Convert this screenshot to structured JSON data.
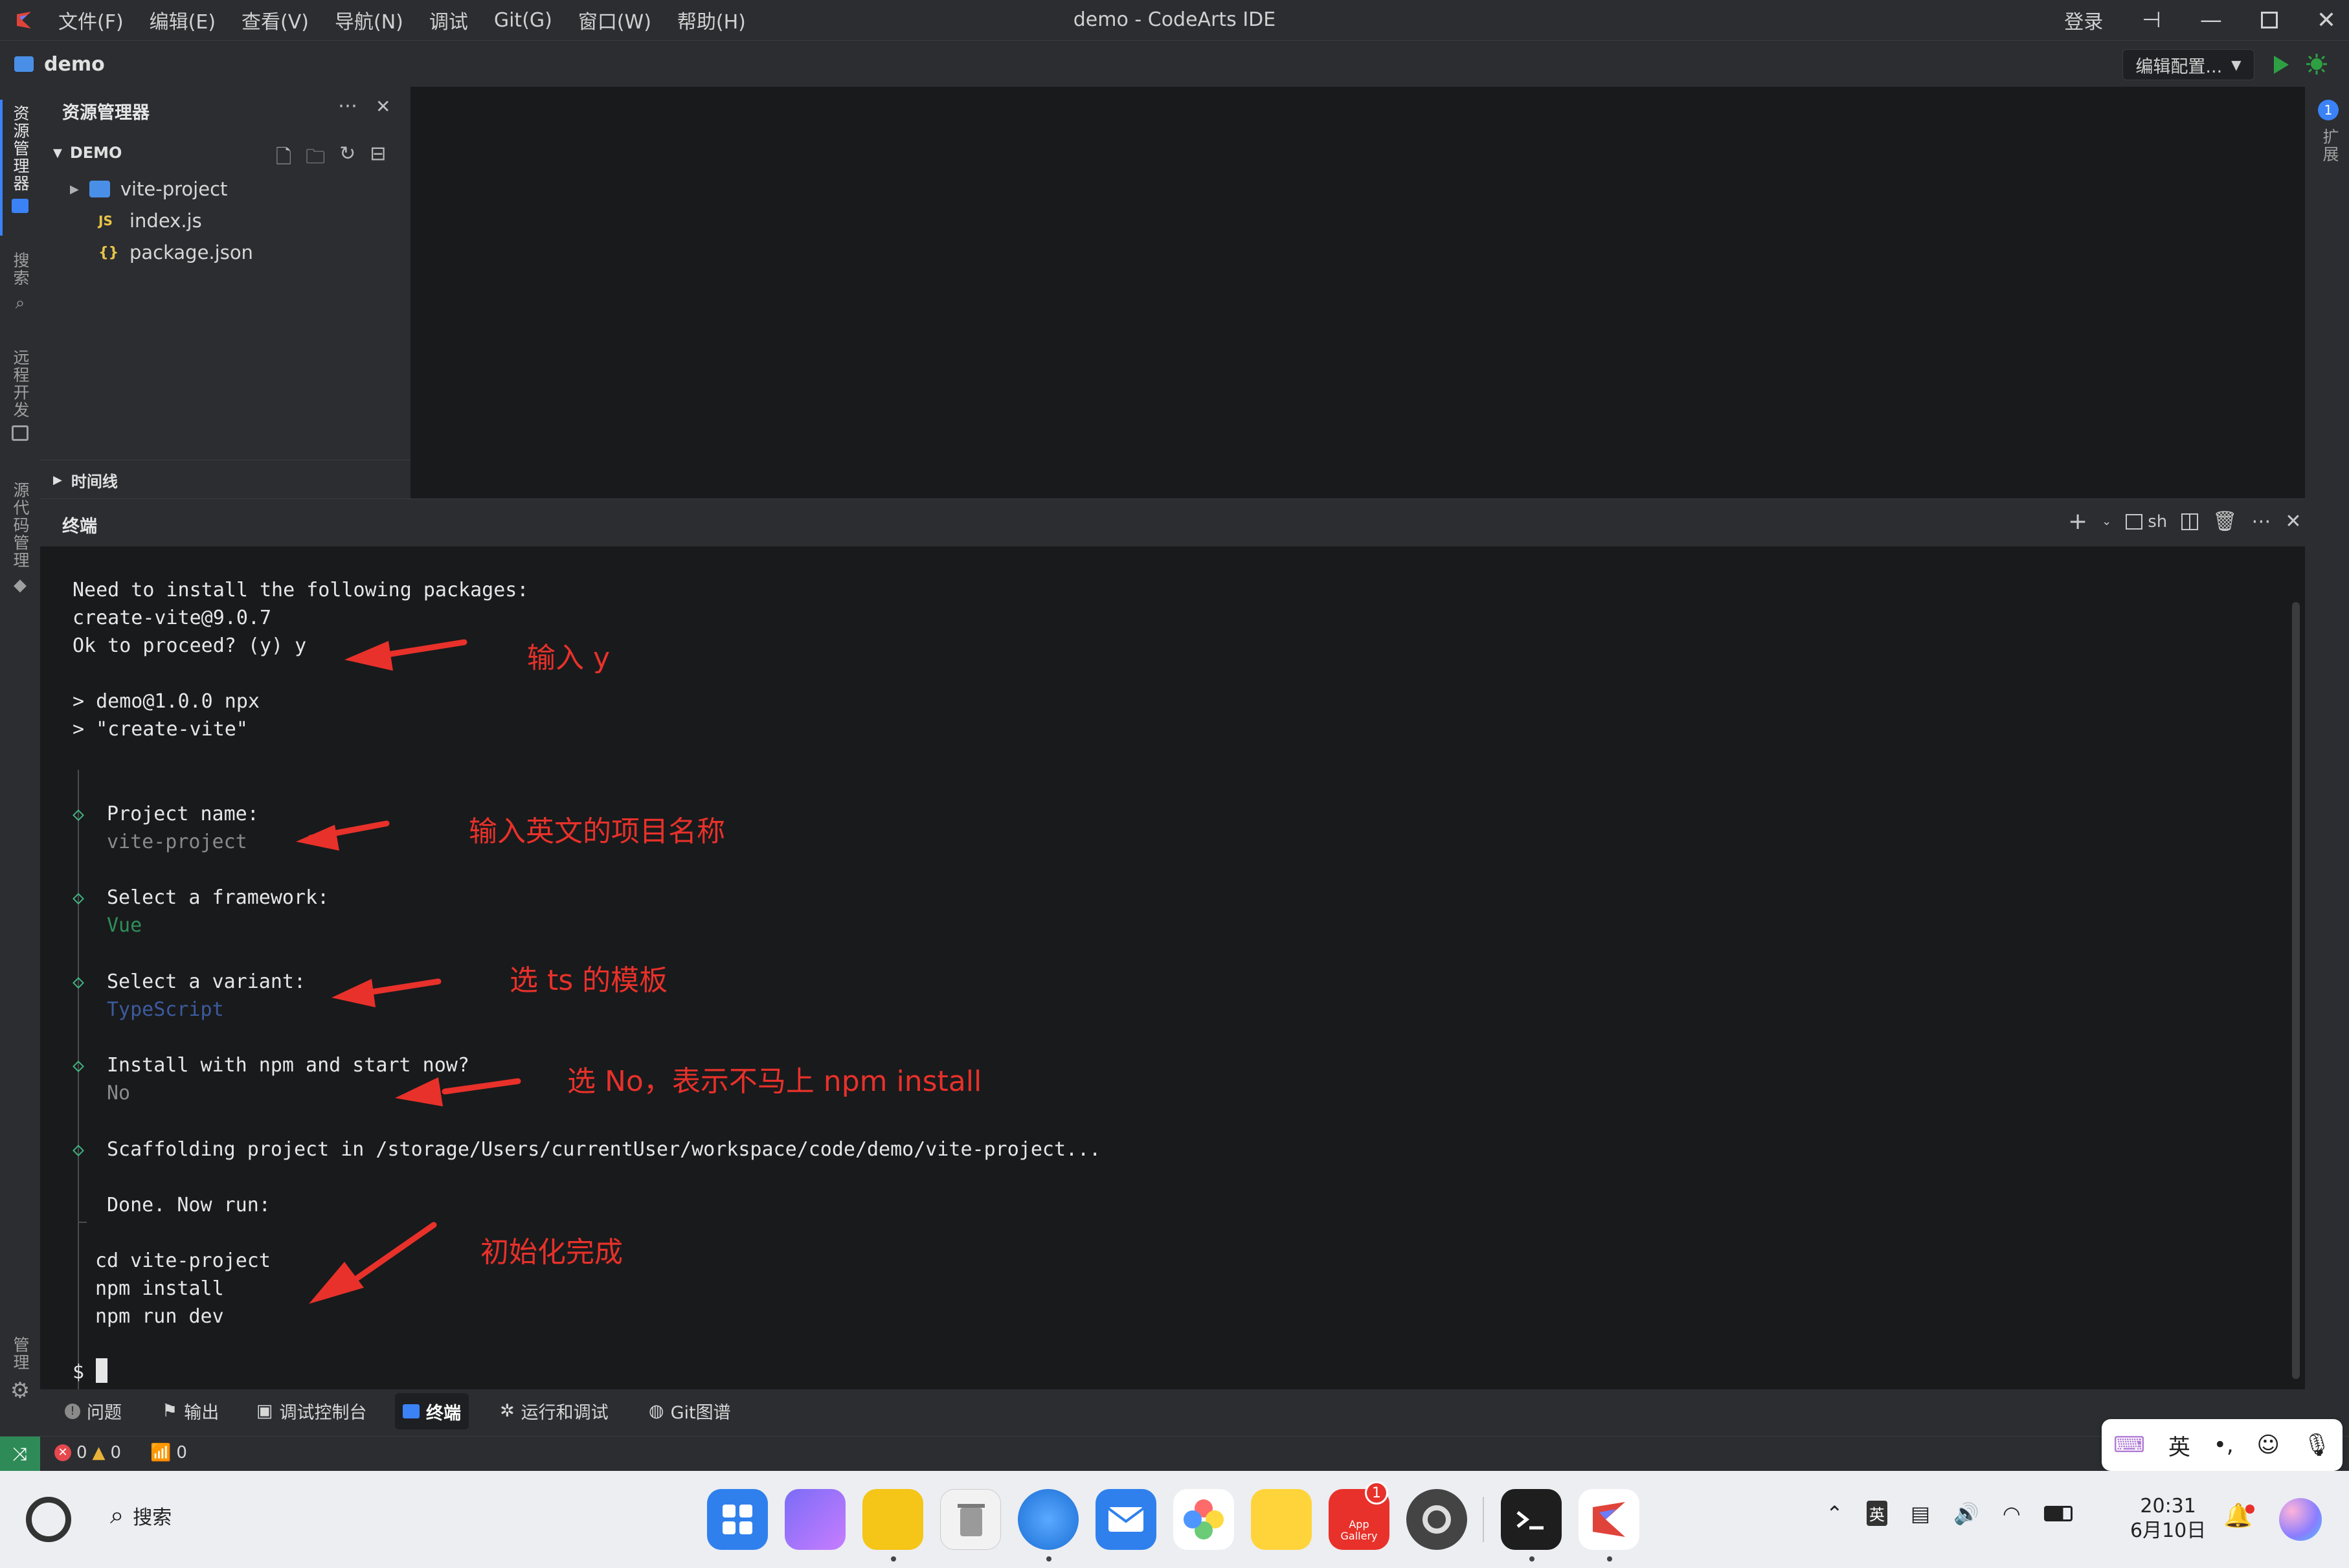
{
  "titlebar": {
    "menu": [
      "文件(F)",
      "编辑(E)",
      "查看(V)",
      "导航(N)",
      "调试",
      "Git(G)",
      "窗口(W)",
      "帮助(H)"
    ],
    "title": "demo - CodeArts IDE",
    "login": "登录"
  },
  "projectbar": {
    "name": "demo",
    "config_label": "编辑配置..."
  },
  "activitybar": {
    "explorer": "资源管理器",
    "search": "搜索",
    "remote": "远程开发",
    "scm": "源代码管理",
    "manage": "管理"
  },
  "rightbar": {
    "extensions": "扩展",
    "badge": "1"
  },
  "explorer": {
    "header": "资源管理器",
    "section": "DEMO",
    "items": [
      {
        "label": "vite-project",
        "icon": "folder-icon"
      },
      {
        "label": "index.js",
        "icon_text": "JS"
      },
      {
        "label": "package.json",
        "icon_text": "{}"
      }
    ],
    "timeline": "时间线"
  },
  "terminal": {
    "title": "终端",
    "shell": "sh",
    "lines": [
      "Need to install the following packages:",
      "create-vite@9.0.7",
      "Ok to proceed? (y) y",
      "> demo@1.0.0 npx",
      "> \"create-vite\"",
      "Project name:",
      "vite-project",
      "Select a framework:",
      "Vue",
      "Select a variant:",
      "TypeScript",
      "Install with npm and start now?",
      "No",
      "Scaffolding project in /storage/Users/currentUser/workspace/code/demo/vite-project...",
      "Done. Now run:",
      "cd vite-project",
      "npm install",
      "npm run dev",
      "$"
    ],
    "annotations": [
      "输入 y",
      "输入英文的项目名称",
      "选 ts 的模板",
      "选 No，表示不马上 npm install",
      "初始化完成"
    ]
  },
  "panel_tabs": [
    "问题",
    "输出",
    "调试控制台",
    "终端",
    "运行和调试",
    "Git图谱"
  ],
  "statusbar": {
    "errors": "0",
    "warnings": "0",
    "ports": "0"
  },
  "ime": {
    "lang": "英"
  },
  "taskbar": {
    "search": "搜索",
    "appgallery_badge": "1",
    "appgallery_label": "App Gallery",
    "tray_lang": "英",
    "time": "20:31",
    "date": "6月10日"
  },
  "colors": {
    "annotation": "#e8312a",
    "accent": "#3b82f6",
    "run": "#2ea043"
  }
}
